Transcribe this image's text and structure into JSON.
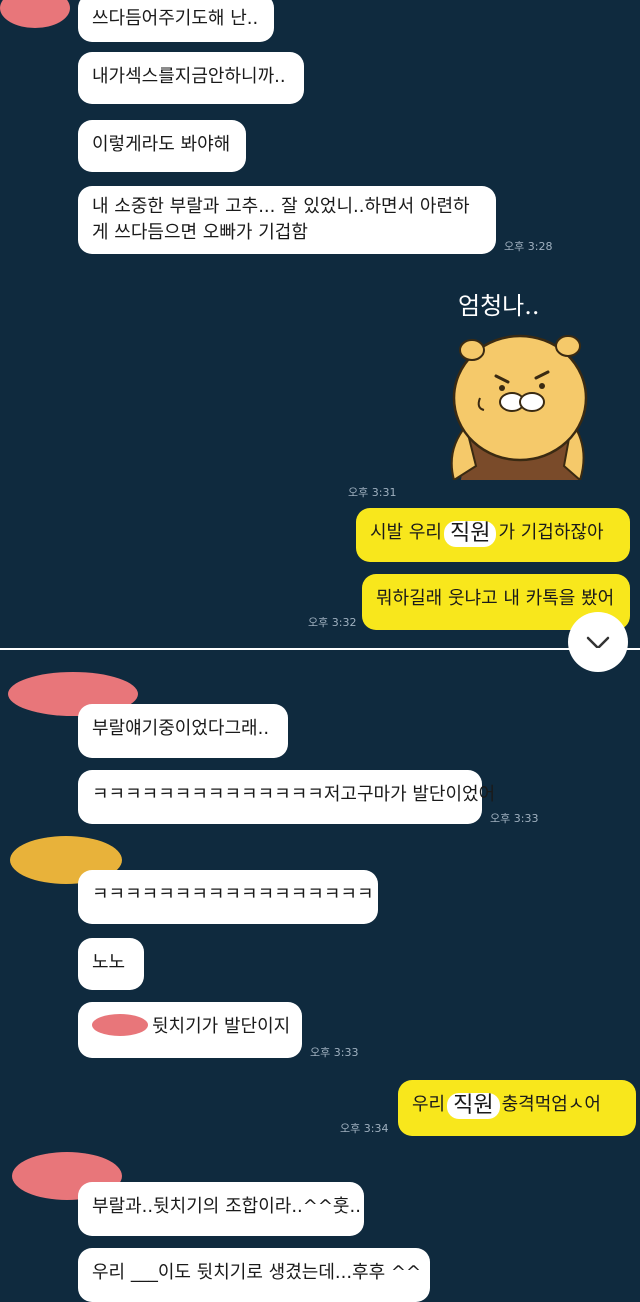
{
  "messages": {
    "m1": "쓰다듬어주기도해 난..",
    "m2": "내가섹스를지금안하니까..",
    "m3": "이렇게라도 봐야해",
    "m4": "내 소중한 부랄과 고추... 잘 있었니..하면서 아련하게 쓰다듬으면 오빠가 기겁함",
    "t1": "오후 3:28",
    "sticker_caption": "엄청나..",
    "t2": "오후 3:31",
    "me1_pre": "시발 우리",
    "me1_hand": "직원",
    "me1_post": "가 기겁하잖아",
    "me2": "뭐하길래 웃냐고 내 카톡을 봤어",
    "t3": "오후 3:32",
    "m5": "부랄얘기중이었다그래..",
    "m6": "ㅋㅋㅋㅋㅋㅋㅋㅋㅋㅋㅋㅋㅋㅋ저고구마가 발단이었어",
    "t4": "오후 3:33",
    "m7": "ㅋㅋㅋㅋㅋㅋㅋㅋㅋㅋㅋㅋㅋㅋㅋㅋㅋ",
    "m8": "노노",
    "m9": "뒷치기가 발단이지",
    "t5": "오후 3:33",
    "me3_pre": "우리",
    "me3_hand": "직원",
    "me3_post": "충격먹엄ㅅ어",
    "t6": "오후 3:34",
    "m10": "부랄과..뒷치기의 조합이라..^^훗..",
    "m11": "우리 ___이도 뒷치기로 생겼는데...후후 ^^"
  },
  "colors": {
    "background": "#0f2a3e",
    "bubble_other": "#ffffff",
    "bubble_me": "#f8e71c",
    "redact_red": "#e8767a",
    "redact_yellow": "#e8b23a"
  },
  "icons": {
    "scroll_down": "chevron-down-icon",
    "sticker": "ryan-sticker"
  }
}
